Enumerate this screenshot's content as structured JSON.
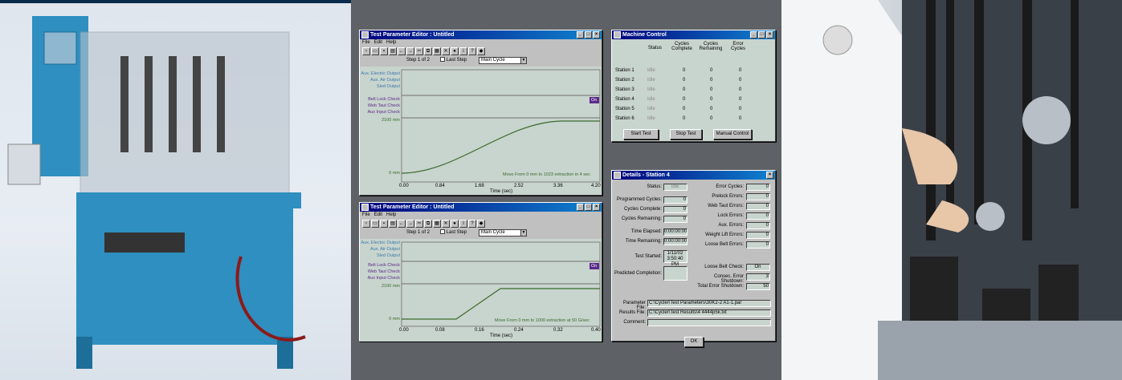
{
  "editor1": {
    "title": "Test Parameter Editor : Untitled",
    "menu": [
      "File",
      "Edit",
      "Help"
    ],
    "step": "Step 1 of 2",
    "last_step": "Last Step",
    "cycle": "Main Cycle",
    "labels": [
      "Aux. Electric Output",
      "Aux. Air Output",
      "Sled Output",
      "Belt Lock Check",
      "Web Taut Check",
      "Aux Input Check",
      "2100 mm",
      "0 mm"
    ],
    "on": "On",
    "note": "Move From 0 mm to 1023 extraction in 4 sec",
    "xticks": [
      "0.00",
      "0.84",
      "1.68",
      "2.52",
      "3.36",
      "4.20"
    ],
    "xlabel": "Time (sec)"
  },
  "editor2": {
    "title": "Test Parameter Editor : Untitled",
    "menu": [
      "File",
      "Edit",
      "Help"
    ],
    "step": "Step 1 of 2",
    "last_step": "Last Step",
    "cycle": "Main Cycle",
    "labels": [
      "Aux. Electric Output",
      "Aux. Air Output",
      "Sled Output",
      "Belt Lock Check",
      "Web Taut Check",
      "Aux Input Check",
      "2100 mm",
      "0 mm"
    ],
    "on": "On",
    "note": "Move From 0 mm to 1000 extraction at 50 G/sec",
    "xticks": [
      "0.00",
      "0.08",
      "0.16",
      "0.24",
      "0.32",
      "0.40"
    ],
    "xlabel": "Time (sec)"
  },
  "machine": {
    "title": "Machine Control",
    "headers": [
      "Status",
      "Cycles Complete",
      "Cycles Remaining",
      "Error Cycles"
    ],
    "rows": [
      {
        "n": "Station 1",
        "s": "Idle",
        "a": "0",
        "b": "0",
        "c": "0"
      },
      {
        "n": "Station 2",
        "s": "Idle",
        "a": "0",
        "b": "0",
        "c": "0"
      },
      {
        "n": "Station 3",
        "s": "Idle",
        "a": "0",
        "b": "0",
        "c": "0"
      },
      {
        "n": "Station 4",
        "s": "Idle",
        "a": "0",
        "b": "0",
        "c": "0"
      },
      {
        "n": "Station 5",
        "s": "Idle",
        "a": "0",
        "b": "0",
        "c": "0"
      },
      {
        "n": "Station 6",
        "s": "Idle",
        "a": "0",
        "b": "0",
        "c": "0"
      }
    ],
    "start": "Start Test",
    "stop": "Stop Test",
    "manual": "Manual Control"
  },
  "details": {
    "title": "Details - Station 4",
    "status_l": "Status:",
    "status_v": "Idle",
    "prog_l": "Programmed Cycles:",
    "prog_v": "0",
    "comp_l": "Cycles Complete:",
    "comp_v": "0",
    "rem_l": "Cycles Remaining:",
    "rem_v": "0",
    "el_l": "Time Elapsed:",
    "el_v": "0:00:00:00",
    "tr_l": "Time Remaining:",
    "tr_v": "0:00:00:00",
    "ts_l": "Test Started:",
    "ts_v1": "1/11/02",
    "ts_v2": "3:50:40 PM",
    "pc_l": "Predicted Completion:",
    "right": [
      {
        "l": "Error Cycles:",
        "v": "0"
      },
      {
        "l": "Prelock Errors:",
        "v": "0"
      },
      {
        "l": "Web Taut Errors:",
        "v": "0"
      },
      {
        "l": "Lock Errors:",
        "v": "0"
      },
      {
        "l": "Aux. Errors:",
        "v": "0"
      },
      {
        "l": "Weight Lift Errors:",
        "v": "0"
      },
      {
        "l": "Loose Belt Errors:",
        "v": "0"
      }
    ],
    "lb_l": "Loose Belt Check:",
    "lb_v": "On",
    "ces_l": "Consec. Error Shutdown:",
    "ces_v": "3",
    "tes_l": "Total Error Shutdown:",
    "tes_v": "50",
    "pf_l": "Parameter File:",
    "pf_v": "C:\\Cycler\\Test Parameters\\30K2-2 A1-1.par",
    "rf_l": "Results File:",
    "rf_v": "C:\\Cycler\\Test Results\\4 4444p5k.txt",
    "cm_l": "Comment:",
    "ok": "OK"
  }
}
